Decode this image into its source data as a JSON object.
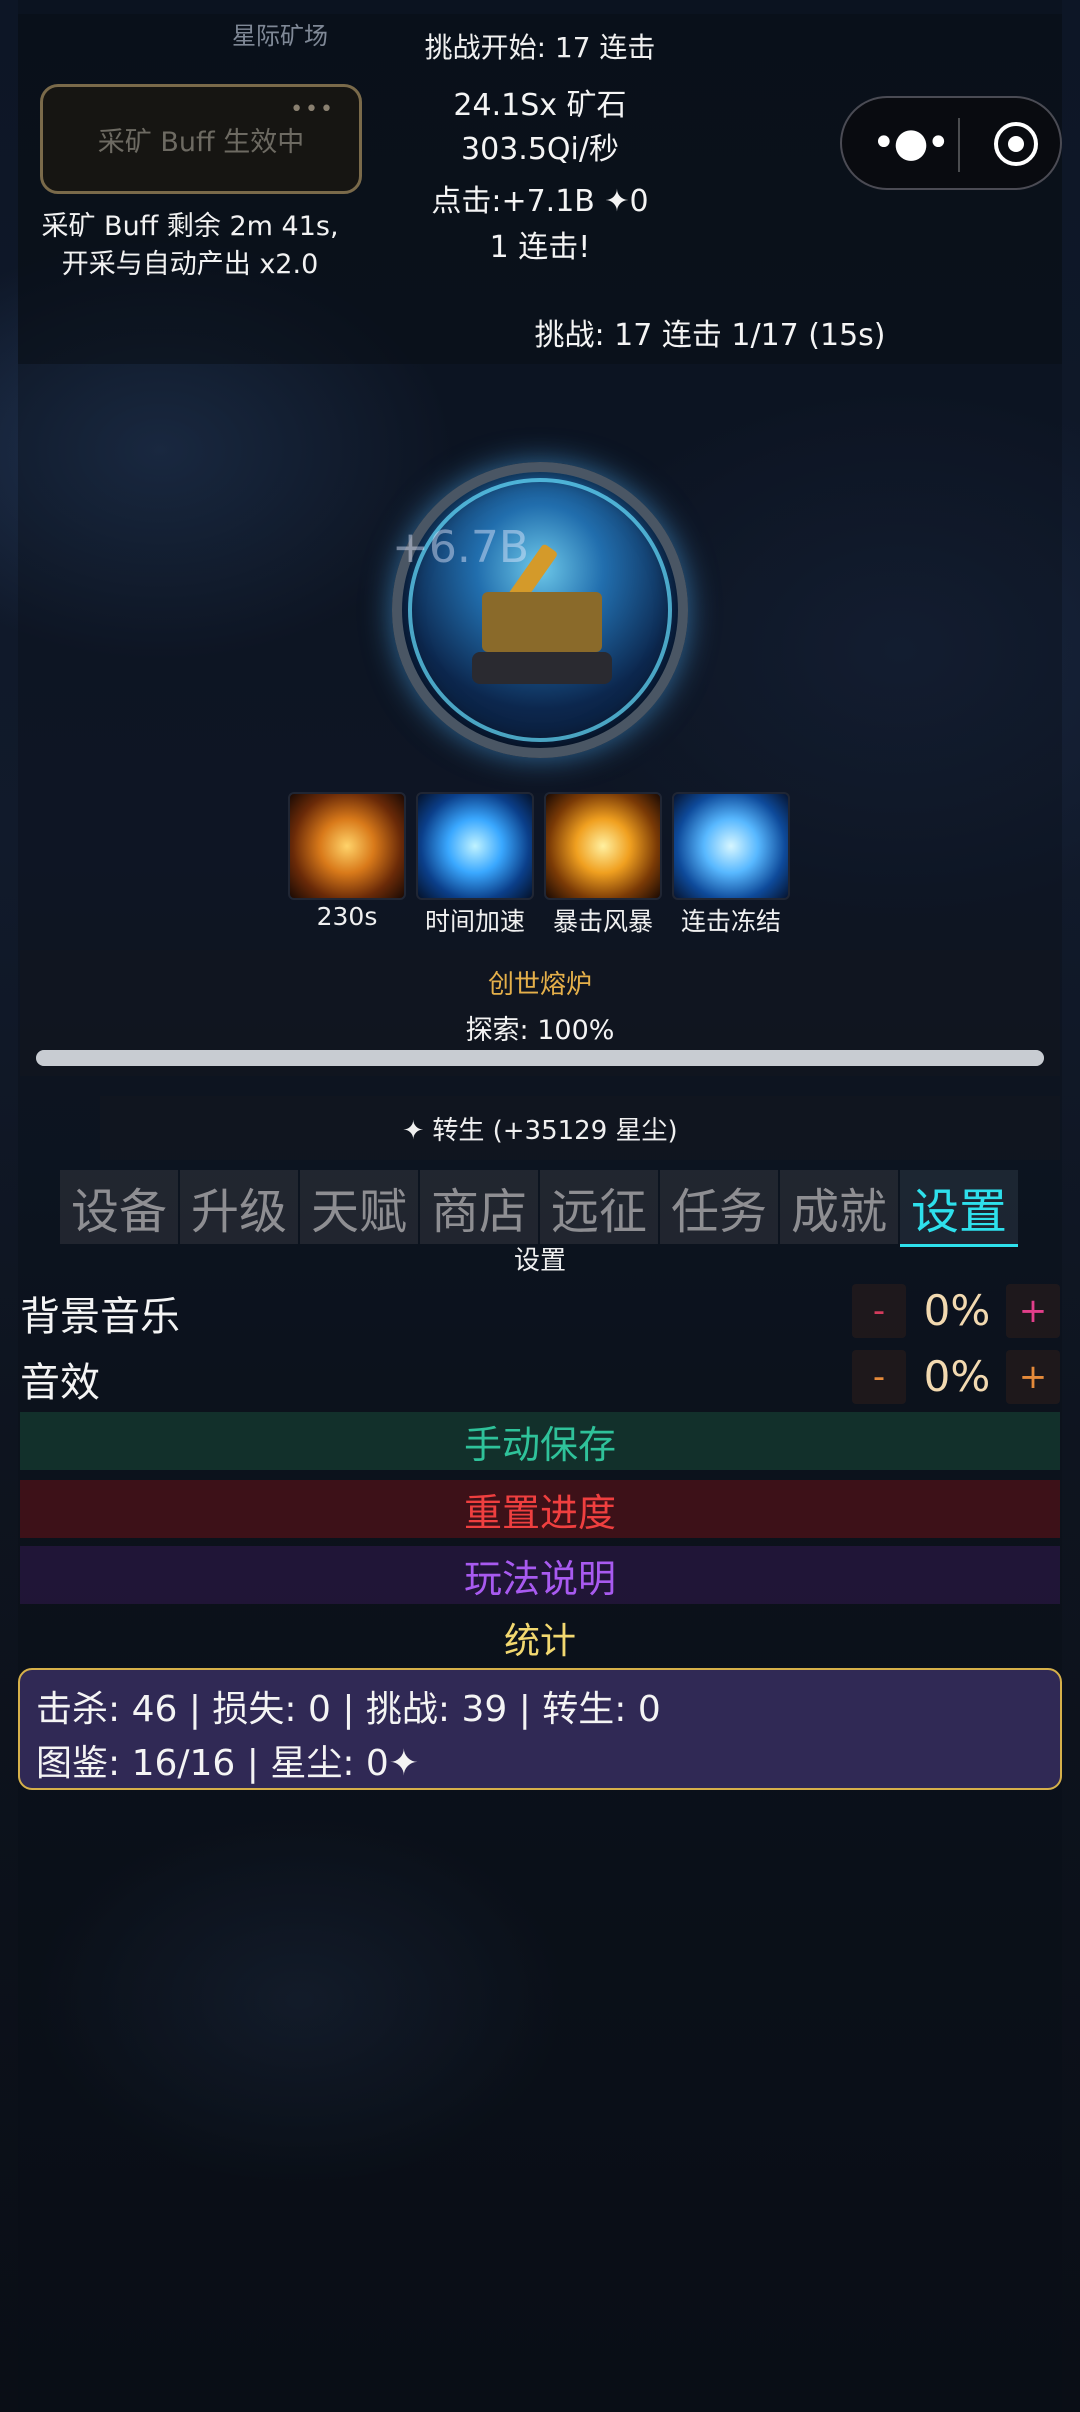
{
  "header": {
    "site_name": "星际矿场",
    "challenge_start": "挑战开始: 17 连击",
    "buff_badge": "采矿 Buff 生效中",
    "buff_dots": "•••",
    "buff_remaining": "采矿 Buff 剩余 2m 41s,",
    "buff_multiplier": "开采与自动产出 x2.0",
    "ore_total": "24.1Sx 矿石",
    "ore_rate": "303.5Qi/秒",
    "click_stat": "点击:+7.1B ✦0",
    "combo": "1 连击!",
    "challenge_status": "挑战: 17 连击  1/17  (15s)"
  },
  "capsule": {
    "more_icon": "more-dots-icon",
    "close_icon": "target-icon"
  },
  "mine": {
    "float_text": "+6.7B"
  },
  "skills": [
    {
      "icon": "fire-skill-icon",
      "label": "230s"
    },
    {
      "icon": "time-accel-icon",
      "label": "时间加速"
    },
    {
      "icon": "crit-storm-icon",
      "label": "暴击风暴"
    },
    {
      "icon": "combo-freeze-icon",
      "label": "连击冻结"
    }
  ],
  "forge": {
    "name": "创世熔炉",
    "explore": "探索: 100%",
    "progress": 1.0
  },
  "rebirth": {
    "label": "✦ 转生 (+35129 星尘)"
  },
  "tabs": [
    "设备",
    "升级",
    "天赋",
    "商店",
    "远征",
    "任务",
    "成就",
    "设置"
  ],
  "active_tab": "设置",
  "section_title": "设置",
  "settings": {
    "music": {
      "label": "背景音乐",
      "minus": "-",
      "value": "0%",
      "plus": "+"
    },
    "sfx": {
      "label": "音效",
      "minus": "-",
      "value": "0%",
      "plus": "+"
    }
  },
  "buttons": {
    "save": "手动保存",
    "reset": "重置进度",
    "help": "玩法说明"
  },
  "stats": {
    "title": "统计",
    "line1": "击杀: 46 | 损失: 0 | 挑战: 39 | 转生: 0",
    "line2": "图鉴: 16/16 | 星尘: 0✦"
  },
  "colors": {
    "accent_cyan": "#2ee0ec",
    "gold": "#e5b04a",
    "save_green": "#2fc29a",
    "reset_red": "#ef3f3f",
    "help_purple": "#a85af0",
    "stats_border": "#d6b04a"
  }
}
